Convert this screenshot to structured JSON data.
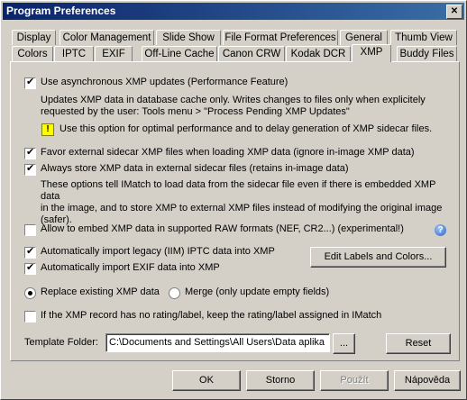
{
  "window": {
    "title": "Program Preferences",
    "close_glyph": "✕"
  },
  "tabs_back": [
    "Display",
    "Color Management",
    "Slide Show",
    "File Format Preferences",
    "General",
    "Thumb View"
  ],
  "tabs_front": [
    "Colors",
    "IPTC",
    "EXIF",
    "Off-Line Cache",
    "Canon CRW",
    "Kodak DCR",
    "XMP",
    "Buddy Files"
  ],
  "active_tab": "XMP",
  "xmp": {
    "async_label": "Use asynchronous XMP updates (Performance Feature)",
    "async_checked": true,
    "async_desc_1": "Updates XMP data in database cache only. Writes changes to files only when explicitely",
    "async_desc_2": "requested by the user: Tools menu > \"Process Pending XMP Updates\"",
    "async_warn_icon": "warning-icon",
    "async_warn_glyph": "!",
    "async_warn": "Use this option for optimal performance and to delay generation of XMP sidecar files.",
    "favor_label": "Favor external sidecar XMP files when loading XMP data  (ignore in-image XMP data)",
    "favor_checked": true,
    "always_label": "Always store XMP data in external sidecar files  (retains in-image data)",
    "always_checked": true,
    "always_desc_1": "These options tell IMatch to load data from the sidecar file even if there is embedded XMP data",
    "always_desc_2": "in the image, and to store XMP to external XMP files instead of modifying the original image",
    "always_desc_3": "(safer).",
    "embed_label": "Allow to embed XMP data in supported RAW formats (NEF, CR2...)  (experimental!)",
    "embed_checked": false,
    "help_icon": "help-icon",
    "help_glyph": "?",
    "legacy_label": "Automatically import legacy (IIM) IPTC data into XMP",
    "legacy_checked": true,
    "exif_label": "Automatically import EXIF data into XMP",
    "exif_checked": true,
    "edit_labels_button": "Edit Labels and Colors...",
    "replace_label": "Replace existing XMP data",
    "merge_label": "Merge (only update empty fields)",
    "replace_selected": true,
    "rating_label": "If the XMP record has no rating/label, keep the rating/label assigned in IMatch",
    "rating_checked": false,
    "template_folder_label": "Template Folder:",
    "template_folder_value": "C:\\Documents and Settings\\All Users\\Data aplika",
    "browse_button": "...",
    "reset_button": "Reset"
  },
  "footer": {
    "ok": "OK",
    "cancel": "Storno",
    "apply": "Použít",
    "help": "Nápověda"
  }
}
